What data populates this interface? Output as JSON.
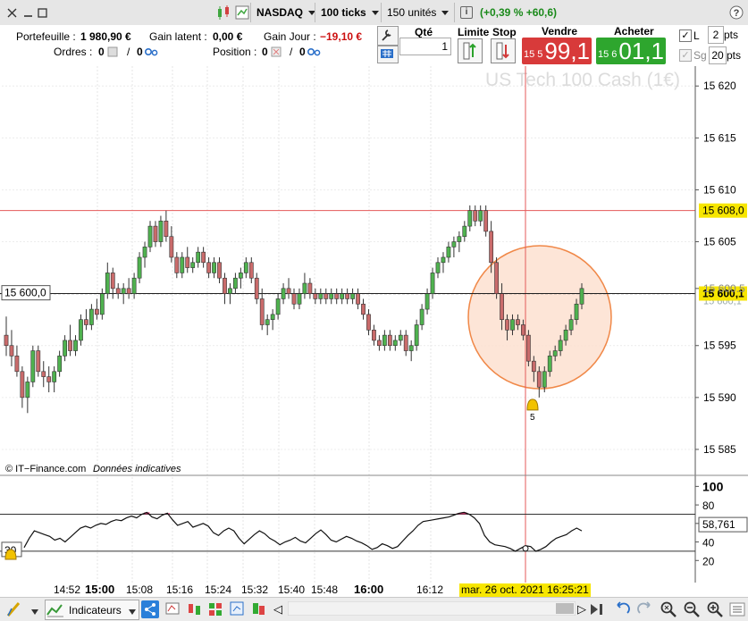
{
  "toolbar": {
    "instrument": "NASDAQ",
    "ticks": "100 ticks",
    "units": "150 unités",
    "change": "(+0,39 % +60,6)"
  },
  "account": {
    "portfolio_label": "Portefeuille :",
    "portfolio_value": "1 980,90 €",
    "latent_label": "Gain latent :",
    "latent_value": "0,00 €",
    "day_label": "Gain Jour :",
    "day_value": "−19,10 €",
    "orders_label": "Ordres :",
    "orders_a": "0",
    "orders_b": "0",
    "position_label": "Position :",
    "position_a": "0",
    "position_b": "0"
  },
  "order": {
    "qty_label": "Qté",
    "qty_value": "1",
    "limit_label": "Limite",
    "stop_label": "Stop",
    "sell_label": "Vendre",
    "buy_label": "Acheter",
    "sell_small": "15 5",
    "sell_big": "99,1",
    "buy_small": "15 6",
    "buy_big": "01,1",
    "l_label": "L",
    "l_pts": "2",
    "sg_label": "Sg",
    "sg_pts": "20",
    "pts_label": "pts"
  },
  "chart": {
    "watermark": "US Tech 100 Cash (1€)",
    "source": "© IT−Finance.com",
    "disclaimer": "Données indicatives",
    "left_level_label": "15 600,0",
    "alert_count": "5",
    "price_ticks": [
      "15 620",
      "15 615",
      "15 610",
      "15 605",
      "15 600.5",
      "15 595",
      "15 590",
      "15 585"
    ],
    "red_line_label": "15 608,0",
    "last_price_label": "15 600,1",
    "ghost_label": "15 600,1",
    "indicator_ticks": [
      "100",
      "80",
      "60",
      "40",
      "20"
    ],
    "indicator_value": "58,761",
    "indicator_level": "30",
    "time_ticks": [
      {
        "label": "14:52",
        "bold": false
      },
      {
        "label": "15:00",
        "bold": true
      },
      {
        "label": "15:08",
        "bold": false
      },
      {
        "label": "15:16",
        "bold": false
      },
      {
        "label": "15:24",
        "bold": false
      },
      {
        "label": "15:32",
        "bold": false
      },
      {
        "label": "15:40",
        "bold": false
      },
      {
        "label": "15:48",
        "bold": false
      },
      {
        "label": "16:00",
        "bold": true
      },
      {
        "label": "16:12",
        "bold": false
      }
    ],
    "crosshair_time": "mar. 26 oct. 2021 16:25:21"
  },
  "bottom": {
    "indicators_label": "Indicateurs"
  },
  "colors": {
    "up": "#4fb24f",
    "down": "#c96b6b",
    "sell": "#d83a3a",
    "buy": "#2ea62e",
    "crosshair": "#e45a5a",
    "circle_fill": "#fde0d0",
    "circle_stroke": "#f08848",
    "highlight": "#f7e600"
  },
  "chart_data": {
    "type": "candlestick",
    "price_range": [
      15582.5,
      15622
    ],
    "candles": [
      [
        15596.0,
        15597.8,
        15594.0,
        15595.0
      ],
      [
        15595.0,
        15596.5,
        15593.0,
        15594.0
      ],
      [
        15594.0,
        15595.0,
        15592.0,
        15592.5
      ],
      [
        15592.5,
        15593.0,
        15589.0,
        15590.0
      ],
      [
        15590.0,
        15592.0,
        15588.5,
        15591.5
      ],
      [
        15591.5,
        15595.0,
        15591.0,
        15594.5
      ],
      [
        15594.5,
        15595.0,
        15592.0,
        15592.5
      ],
      [
        15592.5,
        15593.5,
        15591.0,
        15592.0
      ],
      [
        15592.0,
        15593.0,
        15590.5,
        15591.5
      ],
      [
        15591.5,
        15593.0,
        15590.5,
        15592.5
      ],
      [
        15592.5,
        15594.5,
        15592.0,
        15594.0
      ],
      [
        15594.0,
        15596.0,
        15593.5,
        15595.5
      ],
      [
        15595.5,
        15597.0,
        15594.0,
        15594.5
      ],
      [
        15594.5,
        15596.0,
        15594.0,
        15595.5
      ],
      [
        15595.5,
        15598.0,
        15595.0,
        15597.5
      ],
      [
        15597.5,
        15598.5,
        15596.5,
        15597.0
      ],
      [
        15597.0,
        15599.0,
        15596.5,
        15598.5
      ],
      [
        15598.5,
        15599.5,
        15597.5,
        15598.0
      ],
      [
        15598.0,
        15600.5,
        15597.5,
        15600.0
      ],
      [
        15600.0,
        15603.0,
        15599.5,
        15602.0
      ],
      [
        15602.0,
        15602.5,
        15599.5,
        15600.5
      ],
      [
        15600.5,
        15601.0,
        15599.5,
        15600.0
      ],
      [
        15600.0,
        15601.0,
        15599.0,
        15600.5
      ],
      [
        15600.5,
        15601.5,
        15599.5,
        15600.0
      ],
      [
        15600.0,
        15602.0,
        15599.5,
        15601.5
      ],
      [
        15601.5,
        15604.0,
        15601.0,
        15603.5
      ],
      [
        15603.5,
        15605.0,
        15602.5,
        15604.5
      ],
      [
        15604.5,
        15607.0,
        15604.0,
        15606.5
      ],
      [
        15606.5,
        15607.0,
        15604.5,
        15605.0
      ],
      [
        15605.0,
        15607.5,
        15604.5,
        15607.0
      ],
      [
        15607.0,
        15608.0,
        15605.0,
        15605.5
      ],
      [
        15605.5,
        15606.5,
        15603.0,
        15603.5
      ],
      [
        15603.5,
        15604.0,
        15601.5,
        15602.0
      ],
      [
        15602.0,
        15604.0,
        15601.5,
        15603.5
      ],
      [
        15603.5,
        15604.5,
        15602.0,
        15602.5
      ],
      [
        15602.5,
        15603.5,
        15602.0,
        15603.0
      ],
      [
        15603.0,
        15604.5,
        15602.5,
        15604.0
      ],
      [
        15604.0,
        15604.5,
        15602.5,
        15603.0
      ],
      [
        15603.0,
        15603.5,
        15601.5,
        15602.0
      ],
      [
        15602.0,
        15603.5,
        15601.5,
        15603.0
      ],
      [
        15603.0,
        15603.5,
        15601.0,
        15601.5
      ],
      [
        15601.5,
        15602.0,
        15599.0,
        15600.0
      ],
      [
        15600.0,
        15601.0,
        15599.0,
        15600.5
      ],
      [
        15600.5,
        15602.0,
        15600.0,
        15601.5
      ],
      [
        15601.5,
        15602.5,
        15600.5,
        15602.0
      ],
      [
        15602.0,
        15603.5,
        15601.5,
        15603.0
      ],
      [
        15603.0,
        15603.5,
        15601.0,
        15601.5
      ],
      [
        15601.5,
        15602.0,
        15599.0,
        15599.5
      ],
      [
        15599.5,
        15600.5,
        15596.5,
        15597.0
      ],
      [
        15597.0,
        15598.0,
        15596.0,
        15597.5
      ],
      [
        15597.5,
        15598.5,
        15596.5,
        15598.0
      ],
      [
        15598.0,
        15600.0,
        15597.5,
        15599.5
      ],
      [
        15599.5,
        15601.0,
        15599.0,
        15600.5
      ],
      [
        15600.5,
        15601.5,
        15599.5,
        15600.0
      ],
      [
        15600.0,
        15600.5,
        15598.5,
        15599.0
      ],
      [
        15599.0,
        15600.5,
        15598.5,
        15600.0
      ],
      [
        15600.0,
        15602.0,
        15599.5,
        15601.0
      ],
      [
        15601.0,
        15601.5,
        15599.5,
        15600.0
      ],
      [
        15600.0,
        15600.5,
        15599.0,
        15599.5
      ],
      [
        15599.5,
        15600.5,
        15599.0,
        15600.0
      ],
      [
        15600.0,
        15600.5,
        15599.0,
        15599.5
      ],
      [
        15599.5,
        15600.5,
        15599.0,
        15600.0
      ],
      [
        15600.0,
        15600.5,
        15599.0,
        15599.5
      ],
      [
        15599.5,
        15600.5,
        15599.0,
        15600.0
      ],
      [
        15600.0,
        15600.5,
        15599.0,
        15599.5
      ],
      [
        15599.5,
        15600.5,
        15599.0,
        15600.0
      ],
      [
        15600.0,
        15600.5,
        15598.5,
        15599.0
      ],
      [
        15599.0,
        15599.5,
        15597.5,
        15598.0
      ],
      [
        15598.0,
        15598.5,
        15596.0,
        15596.5
      ],
      [
        15596.5,
        15597.0,
        15595.0,
        15595.5
      ],
      [
        15595.5,
        15596.0,
        15594.5,
        15595.0
      ],
      [
        15595.0,
        15596.5,
        15594.5,
        15596.0
      ],
      [
        15596.0,
        15596.5,
        15594.5,
        15595.0
      ],
      [
        15595.0,
        15596.0,
        15594.5,
        15595.5
      ],
      [
        15595.5,
        15596.5,
        15595.0,
        15596.0
      ],
      [
        15596.0,
        15596.5,
        15594.0,
        15594.5
      ],
      [
        15594.5,
        15595.5,
        15593.5,
        15595.0
      ],
      [
        15595.0,
        15597.5,
        15594.5,
        15597.0
      ],
      [
        15597.0,
        15599.0,
        15596.5,
        15598.5
      ],
      [
        15598.5,
        15600.5,
        15598.0,
        15600.0
      ],
      [
        15600.0,
        15602.5,
        15599.5,
        15602.0
      ],
      [
        15602.0,
        15603.5,
        15601.5,
        15603.0
      ],
      [
        15603.0,
        15604.0,
        15602.0,
        15603.5
      ],
      [
        15603.5,
        15605.0,
        15603.0,
        15604.5
      ],
      [
        15604.5,
        15605.5,
        15603.5,
        15605.0
      ],
      [
        15605.0,
        15606.0,
        15604.0,
        15605.5
      ],
      [
        15605.5,
        15607.0,
        15605.0,
        15606.5
      ],
      [
        15606.5,
        15608.5,
        15606.0,
        15608.0
      ],
      [
        15608.0,
        15608.5,
        15606.5,
        15607.0
      ],
      [
        15607.0,
        15608.5,
        15606.5,
        15608.0
      ],
      [
        15608.0,
        15608.5,
        15605.5,
        15606.0
      ],
      [
        15606.0,
        15607.0,
        15602.0,
        15603.0
      ],
      [
        15603.0,
        15603.5,
        15599.5,
        15600.0
      ],
      [
        15600.0,
        15601.0,
        15596.5,
        15597.5
      ],
      [
        15597.5,
        15598.0,
        15595.5,
        15596.5
      ],
      [
        15596.5,
        15598.0,
        15596.0,
        15597.5
      ],
      [
        15597.5,
        15598.0,
        15596.5,
        15597.0
      ],
      [
        15597.0,
        15597.5,
        15595.5,
        15596.0
      ],
      [
        15596.0,
        15596.5,
        15593.0,
        15593.5
      ],
      [
        15593.5,
        15594.0,
        15591.5,
        15592.5
      ],
      [
        15592.5,
        15593.0,
        15590.0,
        15591.0
      ],
      [
        15591.0,
        15593.0,
        15590.5,
        15592.5
      ],
      [
        15592.5,
        15594.5,
        15592.0,
        15594.0
      ],
      [
        15594.0,
        15595.0,
        15593.5,
        15594.5
      ],
      [
        15594.5,
        15596.0,
        15594.0,
        15595.5
      ],
      [
        15595.5,
        15597.0,
        15595.0,
        15596.5
      ],
      [
        15596.5,
        15598.0,
        15596.0,
        15597.5
      ],
      [
        15597.5,
        15599.5,
        15597.0,
        15599.0
      ],
      [
        15599.0,
        15601.0,
        15598.5,
        15600.5
      ]
    ],
    "indicator": {
      "range": [
        0,
        110
      ],
      "upper_level": 70,
      "lower_level": 30,
      "values": [
        34,
        44,
        52,
        50,
        48,
        46,
        42,
        44,
        40,
        45,
        50,
        55,
        57,
        55,
        58,
        60,
        59,
        62,
        64,
        63,
        66,
        68,
        66,
        70,
        72,
        67,
        65,
        69,
        71,
        64,
        58,
        60,
        62,
        56,
        58,
        60,
        57,
        50,
        47,
        52,
        55,
        52,
        44,
        38,
        43,
        48,
        52,
        49,
        44,
        41,
        37,
        40,
        42,
        45,
        41,
        39,
        44,
        49,
        53,
        48,
        42,
        40,
        43,
        46,
        44,
        41,
        39,
        36,
        32,
        34,
        38,
        36,
        33,
        35,
        41,
        47,
        52,
        58,
        62,
        63,
        64,
        65,
        66,
        67,
        69,
        71,
        72,
        70,
        66,
        60,
        47,
        40,
        37,
        36,
        35,
        33,
        30,
        33,
        36,
        35,
        30,
        32,
        35,
        40,
        44,
        46,
        48,
        52,
        55,
        52
      ]
    }
  }
}
